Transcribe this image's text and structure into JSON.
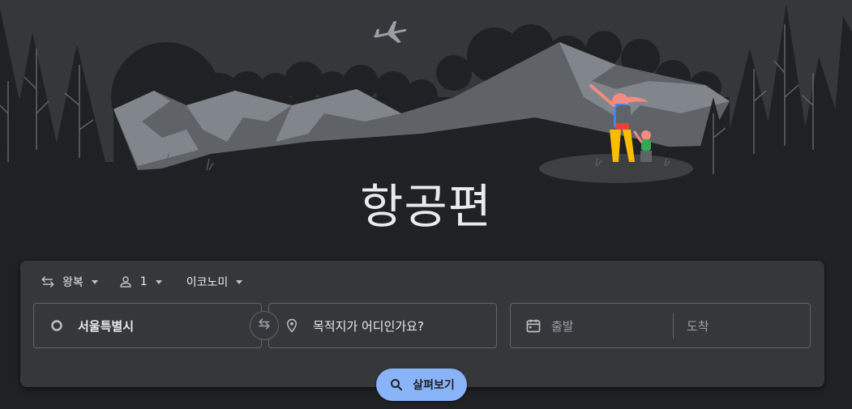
{
  "hero": {
    "title": "항공편"
  },
  "search": {
    "trip_type": {
      "label": "왕복",
      "icon": "round-trip-icon"
    },
    "passengers": {
      "count": "1",
      "icon": "person-icon"
    },
    "cabin_class": {
      "label": "이코노미"
    },
    "origin": {
      "value": "서울특별시",
      "icon": "circle-icon"
    },
    "destination": {
      "placeholder": "목적지가 어디인가요?",
      "icon": "location-pin-icon"
    },
    "swap_icon": "swap-icon",
    "dates": {
      "depart_placeholder": "출발",
      "return_placeholder": "도착",
      "icon": "calendar-icon"
    },
    "search_button": {
      "label": "살펴보기",
      "icon": "search-icon"
    }
  },
  "colors": {
    "background": "#202124",
    "card": "#36373b",
    "accent": "#8ab4f8",
    "border": "#5f6368",
    "text": "#e8eaed",
    "muted_text": "#9aa0a6"
  }
}
